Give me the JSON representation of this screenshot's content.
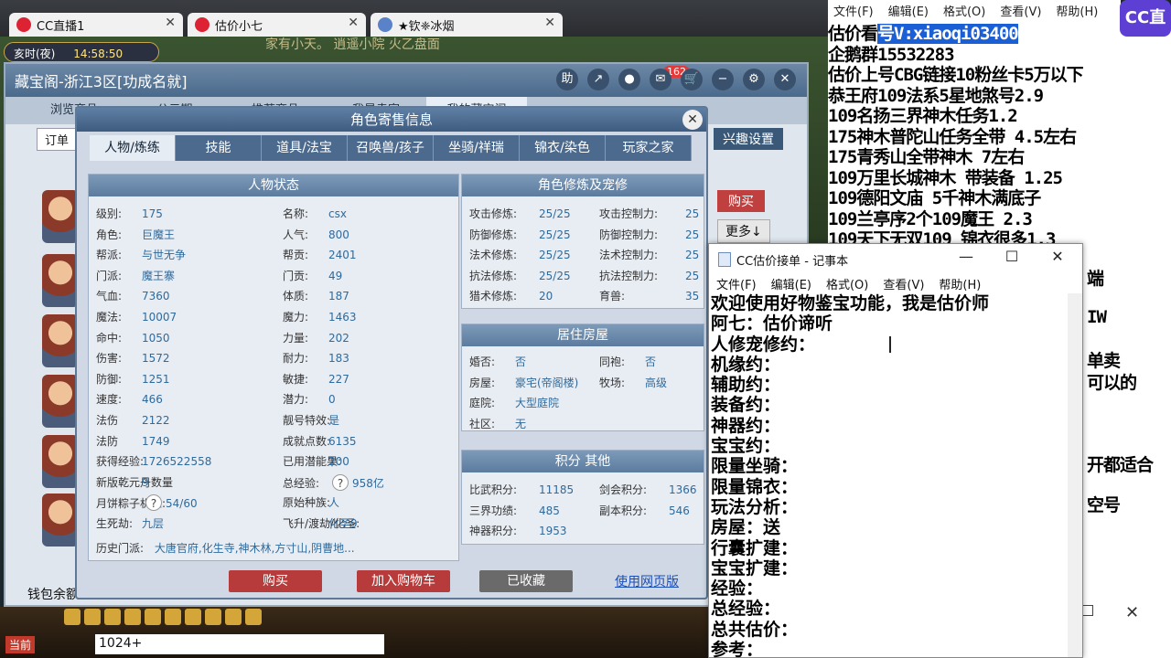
{
  "browser_tabs": [
    {
      "label": "CC直播1"
    },
    {
      "label": "估价小七"
    },
    {
      "label": "★钦❈冰烟"
    }
  ],
  "game": {
    "period": "亥时(夜)",
    "clock": "14:58:50",
    "banner": "家有小天。    逍遥小院    火乙盘面"
  },
  "cbg": {
    "title": "藏宝阁-浙江3区[功成名就]",
    "cart_badge": "162",
    "nav": [
      "浏览商品",
      "公示期",
      "推荐商品",
      "我是卖家",
      "我的藏宝阁"
    ],
    "order_btn": "订单",
    "xingqu_btn": "兴趣设置",
    "buy_btn": "购买",
    "more_btn": "更多↓",
    "wallet": "钱包余额"
  },
  "modal": {
    "title": "角色寄售信息",
    "close": "✕",
    "tabs": [
      "人物/炼练",
      "技能",
      "道具/法宝",
      "召唤兽/孩子",
      "坐骑/祥瑞",
      "锦衣/染色",
      "玩家之家"
    ],
    "status_title": "人物状态",
    "status_left": [
      {
        "k": "级别:",
        "v": "175"
      },
      {
        "k": "角色:",
        "v": "巨魔王"
      },
      {
        "k": "帮派:",
        "v": "与世无争"
      },
      {
        "k": "门派:",
        "v": "魔王寨"
      },
      {
        "k": "气血:",
        "v": "7360"
      },
      {
        "k": "魔法:",
        "v": "10007"
      },
      {
        "k": "命中:",
        "v": "1050"
      },
      {
        "k": "伤害:",
        "v": "1572"
      },
      {
        "k": "防御:",
        "v": "1251"
      },
      {
        "k": "速度:",
        "v": "466"
      },
      {
        "k": "法伤",
        "v": "2122"
      },
      {
        "k": "法防",
        "v": "1749"
      },
      {
        "k": "获得经验:",
        "v": "1726522558"
      },
      {
        "k": "新版乾元丹数量",
        "v": "9"
      },
      {
        "k": "月饼粽子机缘:",
        "v": "54/60"
      },
      {
        "k": "生死劫:",
        "v": "九层"
      }
    ],
    "status_right": [
      {
        "k": "名称:",
        "v": "csx"
      },
      {
        "k": "人气:",
        "v": "800"
      },
      {
        "k": "帮贡:",
        "v": "2401"
      },
      {
        "k": "门贡:",
        "v": "49"
      },
      {
        "k": "体质:",
        "v": "187"
      },
      {
        "k": "魔力:",
        "v": "1463"
      },
      {
        "k": "力量:",
        "v": "202"
      },
      {
        "k": "耐力:",
        "v": "183"
      },
      {
        "k": "敏捷:",
        "v": "227"
      },
      {
        "k": "潜力:",
        "v": "0"
      },
      {
        "k": "靓号特效:",
        "v": "是"
      },
      {
        "k": "成就点数:",
        "v": "6135"
      },
      {
        "k": "已用潜能果:",
        "v": "200"
      },
      {
        "k": "总经验:",
        "v": "958亿"
      },
      {
        "k": "原始种族:",
        "v": "人"
      },
      {
        "k": "飞升/渡劫/化圣:",
        "v": "化圣9"
      }
    ],
    "history": {
      "k": "历史门派:",
      "v": "大唐官府,化生寺,神木林,方寸山,阴曹地..."
    },
    "xl_title": "角色修炼及宠修",
    "xl_left": [
      {
        "k": "攻击修炼:",
        "v": "25/25"
      },
      {
        "k": "防御修炼:",
        "v": "25/25"
      },
      {
        "k": "法术修炼:",
        "v": "25/25"
      },
      {
        "k": "抗法修炼:",
        "v": "25/25"
      },
      {
        "k": "猎术修炼:",
        "v": "20"
      }
    ],
    "xl_right": [
      {
        "k": "攻击控制力:",
        "v": "25"
      },
      {
        "k": "防御控制力:",
        "v": "25"
      },
      {
        "k": "法术控制力:",
        "v": "25"
      },
      {
        "k": "抗法控制力:",
        "v": "25"
      },
      {
        "k": "育兽:",
        "v": "35"
      }
    ],
    "house_title": "居住房屋",
    "house": [
      {
        "k": "婚否:",
        "v": "否"
      },
      {
        "k": "同袍:",
        "v": "否"
      },
      {
        "k": "房屋:",
        "v": "豪宅(帝阁楼)"
      },
      {
        "k": "牧场:",
        "v": "高级"
      },
      {
        "k": "庭院:",
        "v": "大型庭院"
      },
      {
        "k": "社区:",
        "v": "无"
      }
    ],
    "score_title": "积分 其他",
    "score": [
      {
        "k": "比武积分:",
        "v": "11185"
      },
      {
        "k": "剑会积分:",
        "v": "1366"
      },
      {
        "k": "三界功绩:",
        "v": "485"
      },
      {
        "k": "副本积分:",
        "v": "546"
      },
      {
        "k": "神器积分:",
        "v": "1953"
      }
    ],
    "buttons": {
      "buy": "购买",
      "cart": "加入购物车",
      "fav": "已收藏",
      "web": "使用网页版"
    }
  },
  "chat": {
    "now": "当前",
    "input": "1024+"
  },
  "right_panel": {
    "menu": [
      "文件(F)",
      "编辑(E)",
      "格式(O)",
      "查看(V)",
      "帮助(H)"
    ],
    "logo": "CC直播",
    "lines": [
      {
        "pre": "估价看",
        "hl": "号V:xiaoqi03400"
      },
      {
        "pre": "企鹅群15532283",
        "hl": ""
      },
      {
        "pre": "估价上号CBG链接10粉丝卡5万以下",
        "hl": ""
      },
      {
        "pre": "恭王府109法系5星地煞号2.9",
        "hl": ""
      },
      {
        "pre": "109名扬三界神木任务1.2",
        "hl": ""
      },
      {
        "pre": "175神木普陀山任务全带 4.5左右",
        "hl": ""
      },
      {
        "pre": "175青秀山全带神木  7左右",
        "hl": ""
      },
      {
        "pre": "109万里长城神木 带装备  1.25",
        "hl": ""
      },
      {
        "pre": "109德阳文庙 5千神木满底子",
        "hl": ""
      },
      {
        "pre": "109兰亭序2个109魔王 2.3",
        "hl": ""
      },
      {
        "pre": "109天下无双109  锦衣很多1.3",
        "hl": ""
      }
    ],
    "fragments": [
      "端",
      "IW",
      "单卖",
      "可以的",
      "开都适合",
      "空号"
    ]
  },
  "notepad": {
    "title": "CC估价接单 - 记事本",
    "menu": [
      "文件(F)",
      "编辑(E)",
      "格式(O)",
      "查看(V)",
      "帮助(H)"
    ],
    "lines": [
      "欢迎使用好物鉴宝功能，我是估价师",
      "阿七：估价谛听",
      "人修宠修约：",
      "机缘约：",
      "辅助约：",
      "装备约：",
      "神器约：",
      "宝宝约：",
      "限量坐骑：",
      "限量锦衣：",
      "玩法分析：",
      "房屋：送",
      "行囊扩建：",
      "宝宝扩建：",
      "经验：",
      "总经验：",
      "总共估价：",
      "参考："
    ]
  }
}
